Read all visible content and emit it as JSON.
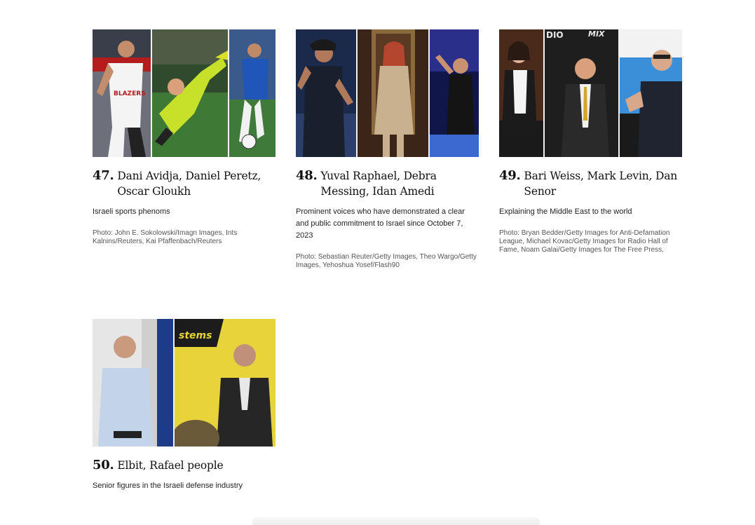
{
  "cards": [
    {
      "rank": "47.",
      "names": "Dani Avidja, Daniel Peretz, Oscar Gloukh",
      "description": "Israeli sports phenoms",
      "credit": "Photo: John E. Sokolowski/Imagn Images, Ints Kalnins/Reuters, Kai Pfaffenbach/Reuters",
      "jersey_text": "BLAZERS"
    },
    {
      "rank": "48.",
      "names": "Yuval Raphael, Debra Messing, Idan Amedi",
      "description": "Prominent voices who have demonstrated a clear and public commitment to Israel since October 7, 2023",
      "credit": "Photo: Sebastian Reuter/Getty Images, Theo Wargo/Getty Images, Yehoshua Yosef/Flash90"
    },
    {
      "rank": "49.",
      "names": "Bari Weiss, Mark Levin, Dan Senor",
      "description": "Explaining the Middle East to the world",
      "credit": "Photo: Bryan Bedder/Getty Images for Anti-Defamation League, Michael Kovac/Getty Images for Radio Hall of Fame, Noam Galai/Getty Images for The Free Press,",
      "backdrop_text_1": "DIO",
      "backdrop_text_2": "MIX"
    },
    {
      "rank": "50.",
      "names": "Elbit, Rafael people",
      "description": "Senior figures in the Israeli defense industry",
      "banner_text": "stems"
    }
  ]
}
